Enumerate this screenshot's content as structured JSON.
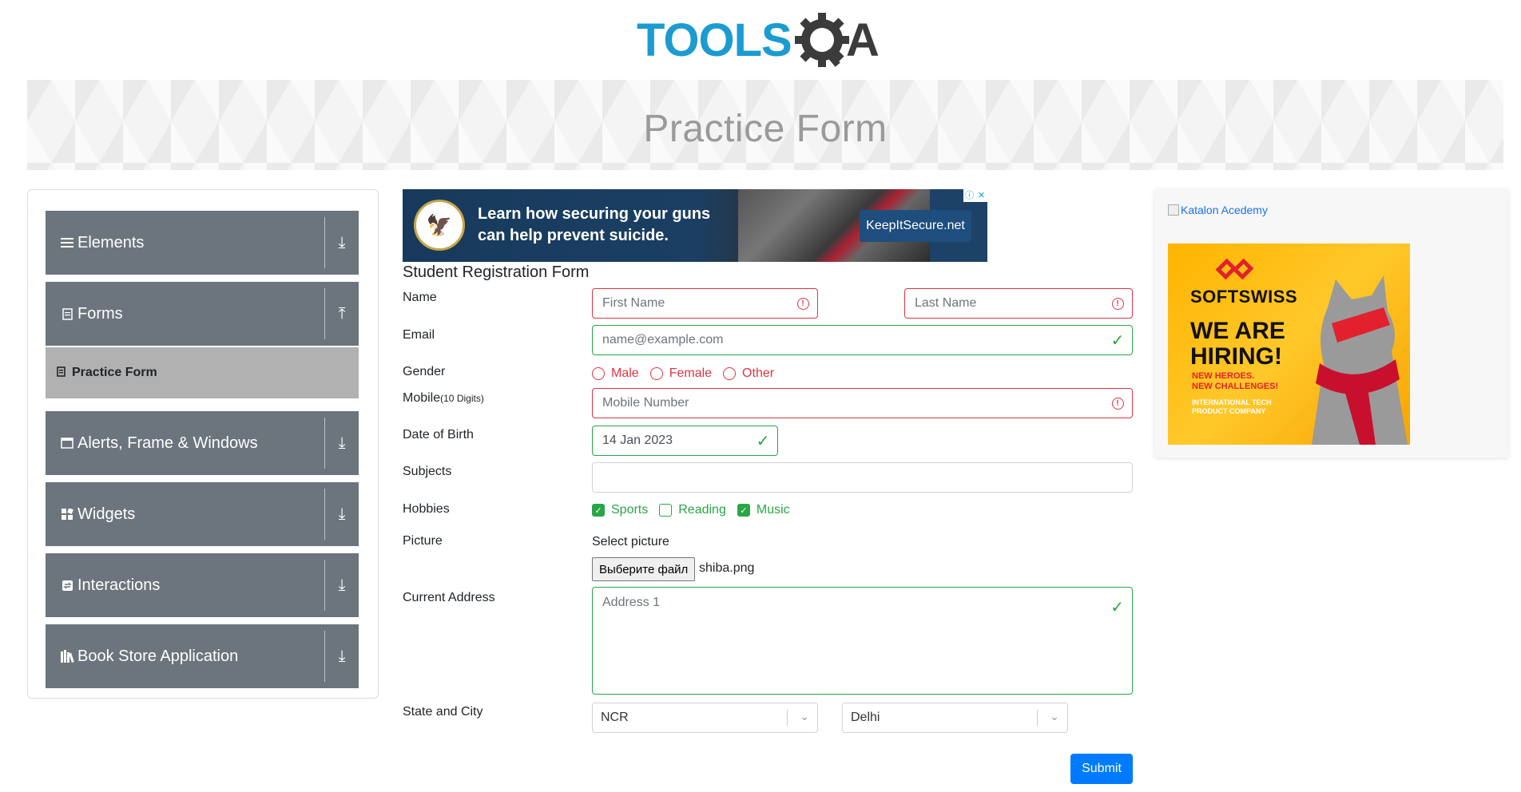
{
  "header": {
    "logo_text": "TOOLSQA",
    "page_title": "Practice Form"
  },
  "sidebar": {
    "groups": [
      {
        "label": "Elements",
        "icon": "menu-icon",
        "expanded": false
      },
      {
        "label": "Forms",
        "icon": "form-icon",
        "expanded": true,
        "items": [
          {
            "label": "Practice Form",
            "active": true
          }
        ]
      },
      {
        "label": "Alerts, Frame & Windows",
        "icon": "window-icon",
        "expanded": false
      },
      {
        "label": "Widgets",
        "icon": "widgets-icon",
        "expanded": false
      },
      {
        "label": "Interactions",
        "icon": "interactions-icon",
        "expanded": false
      },
      {
        "label": "Book Store Application",
        "icon": "books-icon",
        "expanded": false
      }
    ]
  },
  "ad_banner": {
    "headline_line1": "Learn how securing your guns",
    "headline_line2": "can help prevent suicide.",
    "cta": "KeepItSecure.net"
  },
  "form": {
    "title": "Student Registration Form",
    "labels": {
      "name": "Name",
      "email": "Email",
      "gender": "Gender",
      "mobile": "Mobile",
      "mobile_hint": "(10 Digits)",
      "dob": "Date of Birth",
      "subjects": "Subjects",
      "hobbies": "Hobbies",
      "picture": "Picture",
      "address": "Current Address",
      "state_city": "State and City"
    },
    "first_name": {
      "placeholder": "First Name",
      "value": "",
      "state": "invalid"
    },
    "last_name": {
      "placeholder": "Last Name",
      "value": "",
      "state": "invalid"
    },
    "email": {
      "placeholder": "name@example.com",
      "value": "",
      "state": "valid"
    },
    "gender_options": [
      "Male",
      "Female",
      "Other"
    ],
    "mobile": {
      "placeholder": "Mobile Number",
      "value": "",
      "state": "invalid"
    },
    "dob": {
      "value": "14 Jan 2023",
      "state": "valid"
    },
    "subjects": {
      "value": ""
    },
    "hobbies": [
      {
        "label": "Sports",
        "checked": true
      },
      {
        "label": "Reading",
        "checked": false
      },
      {
        "label": "Music",
        "checked": true
      }
    ],
    "picture": {
      "select_label": "Select picture",
      "button": "Выберите файл",
      "file_name": "shiba.png"
    },
    "address": {
      "placeholder": "Address 1",
      "state": "valid"
    },
    "state": "NCR",
    "city": "Delhi",
    "submit": "Submit"
  },
  "side_ad": {
    "broken_alt": "Katalon Acedemy",
    "brand": "SOFTSWISS",
    "hiring_line1": "WE ARE",
    "hiring_line2": "HIRING!",
    "sub_line1": "NEW HEROES.",
    "sub_line2": "NEW CHALLENGES!",
    "intl_line1": "INTERNATIONAL TECH",
    "intl_line2": "PRODUCT COMPANY"
  },
  "colors": {
    "sidebar_header": "#6c757d",
    "active_item": "#b1b1b1",
    "invalid": "#dc3545",
    "valid": "#28a745",
    "primary": "#007bff"
  }
}
